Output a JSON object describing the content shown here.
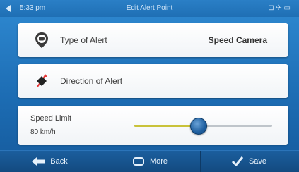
{
  "status_bar": {
    "time": "5:33 pm",
    "title": "Edit Alert Point",
    "icons": "⊡ ✈ ▭"
  },
  "rows": [
    {
      "label": "Type of Alert",
      "value": "Speed Camera",
      "icon": "camera-pin-icon"
    },
    {
      "label": "Direction of Alert",
      "value": "",
      "icon": "direction-arrow-icon"
    }
  ],
  "speed_limit": {
    "label": "Speed Limit",
    "value": "80 km/h",
    "slider_fraction": 0.46
  },
  "bottom_bar": {
    "back_label": "Back",
    "more_label": "More",
    "save_label": "Save"
  },
  "colors": {
    "background": "#1d6db4",
    "card": "#f4f6f8",
    "slider_fill": "#c9c23a",
    "thumb": "#2a6cad"
  }
}
